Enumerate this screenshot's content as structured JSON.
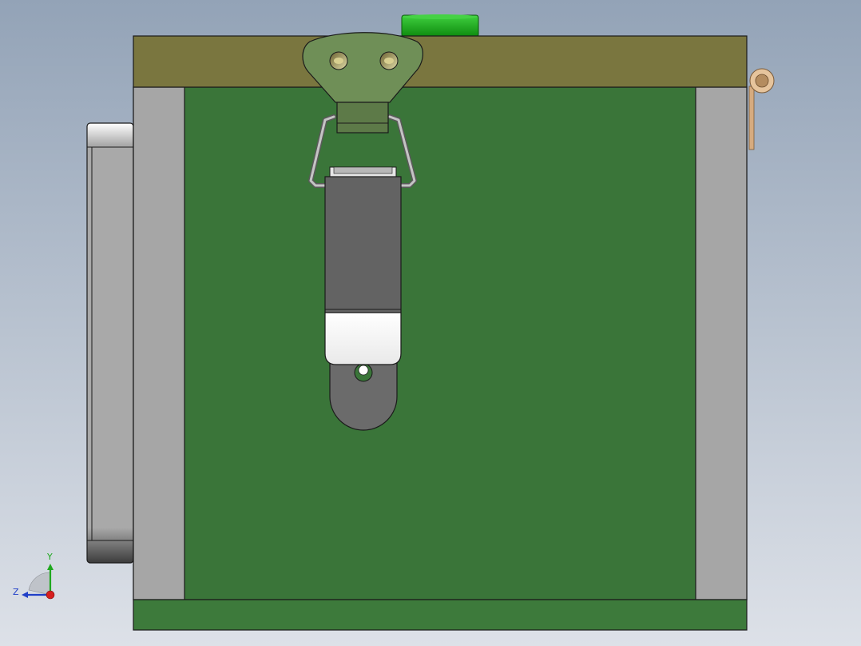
{
  "viewport": {
    "background_top": "#93a3b7",
    "background_bottom": "#dde1e8"
  },
  "part_colors": {
    "frame_outline": "#1a1a1a",
    "top_rail": "#7a763f",
    "main_panel": "#3a7539",
    "bottom_rail": "#3d7a3b",
    "side_rail": "#a6a6a6",
    "left_block": "#a9a9a9",
    "knob": "#1aa51a",
    "hinge_plate": "#6f8f57",
    "latch_body": "#636363",
    "latch_tab": "#ffffff",
    "catch_plate": "#6b6b6b",
    "wire_loop": "#b8b8b8",
    "pin": "#d6ab7f"
  },
  "triad": {
    "axis_y": "Y",
    "axis_z": "Z",
    "y_color": "#1fa81f",
    "z_color": "#2140c8",
    "x_color": "#d61f1f"
  }
}
